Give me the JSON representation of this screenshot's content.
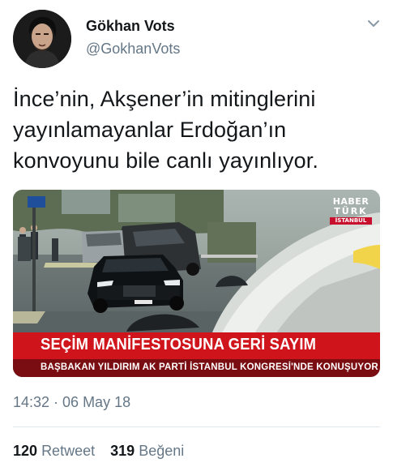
{
  "author": {
    "display_name": "Gökhan Vots",
    "handle": "@GokhanVots",
    "avatar_icon": "profile-photo"
  },
  "tweet": {
    "lines": [
      "İnce’nin, Akşener’in mitinglerini",
      "yayınlamayanlar Erdoğan’ın",
      "konvoyunu bile canlı yayınlıyor."
    ]
  },
  "media": {
    "logo_line1": "HABER",
    "logo_line2": "TÜRK",
    "logo_line3": "İSTANBUL",
    "banner_title": "SEÇİM MANİFESTOSUNA GERİ SAYIM",
    "banner_subtitle": "BAŞBAKAN YILDIRIM AK PARTİ İSTANBUL KONGRESİ'NDE KONUŞUYOR"
  },
  "meta": {
    "timestamp": "14:32 · 06 May 18",
    "retweet_count": "120",
    "retweet_label": "Retweet",
    "like_count": "319",
    "like_label": "Beğeni"
  },
  "colors": {
    "text_primary": "#14171a",
    "text_secondary": "#657786",
    "banner_red": "#d0141c",
    "divider": "#e1e8ed"
  }
}
